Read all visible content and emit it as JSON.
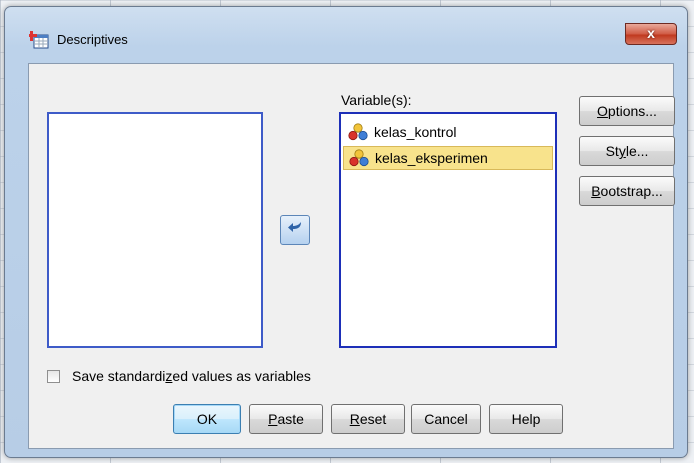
{
  "window": {
    "title": "Descriptives",
    "close_glyph": "x"
  },
  "target": {
    "label": "Variable(s):",
    "items": [
      {
        "name": "kelas_kontrol",
        "selected": false,
        "icon": "scale-variable-icon"
      },
      {
        "name": "kelas_eksperimen",
        "selected": true,
        "icon": "scale-variable-icon"
      }
    ]
  },
  "side_buttons": [
    {
      "label_pre": "",
      "label_u": "O",
      "label_post": "ptions..."
    },
    {
      "label_pre": "St",
      "label_u": "y",
      "label_post": "le..."
    },
    {
      "label_pre": "",
      "label_u": "B",
      "label_post": "ootstrap..."
    }
  ],
  "checkbox": {
    "label_pre": "Save standardi",
    "label_u": "z",
    "label_post": "ed values as variables",
    "checked": false
  },
  "buttons": {
    "ok": {
      "label_pre": "OK",
      "label_u": "",
      "label_post": ""
    },
    "paste": {
      "label_pre": "",
      "label_u": "P",
      "label_post": "aste"
    },
    "reset": {
      "label_pre": "",
      "label_u": "R",
      "label_post": "eset"
    },
    "cancel": {
      "label_pre": "Cancel",
      "label_u": "",
      "label_post": ""
    },
    "help": {
      "label_pre": "Help",
      "label_u": "",
      "label_post": ""
    }
  },
  "colors": {
    "selection": "#f8e38c",
    "list_border": "#1d2fb8",
    "close_button": "#c0391f",
    "default_button": "#bee6fd"
  }
}
